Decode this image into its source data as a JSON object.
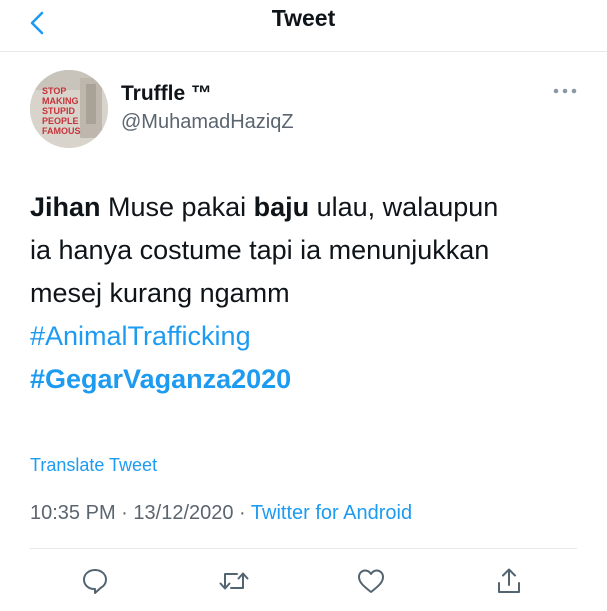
{
  "nav": {
    "title": "Tweet",
    "back_icon": "chevron-left-icon"
  },
  "author": {
    "display_name": "Truffle ™",
    "handle": "@MuhamadHaziqZ",
    "avatar_text": [
      "STOP",
      "MAKING",
      "STUPID",
      "PEOPLE",
      "FAMOUS"
    ],
    "more_icon": "more-icon"
  },
  "tweet": {
    "lines": [
      [
        {
          "text": "Jihan",
          "bold": true
        },
        {
          "text": " Muse pakai "
        },
        {
          "text": "baju",
          "bold": true
        },
        {
          "text": " ulau, walaupun"
        }
      ],
      [
        {
          "text": "ia hanya costume tapi ia menunjukkan"
        }
      ],
      [
        {
          "text": "mesej kurang ngamm"
        }
      ]
    ],
    "hashtags": [
      "#AnimalTrafficking",
      "#GegarVaganza2020"
    ]
  },
  "translate_label": "Translate Tweet",
  "meta": {
    "time": "10:35 PM",
    "separator": " · ",
    "date": "13/12/2020",
    "source": "Twitter for Android"
  },
  "actions": [
    {
      "name": "reply",
      "icon": "reply-icon"
    },
    {
      "name": "retweet",
      "icon": "retweet-icon"
    },
    {
      "name": "like",
      "icon": "heart-icon"
    },
    {
      "name": "share",
      "icon": "share-icon"
    }
  ],
  "colors": {
    "accent": "#1d9bf0",
    "text": "#0f1419",
    "secondary": "#5b6570",
    "icon": "#536471",
    "divider": "#e6e9ec"
  }
}
